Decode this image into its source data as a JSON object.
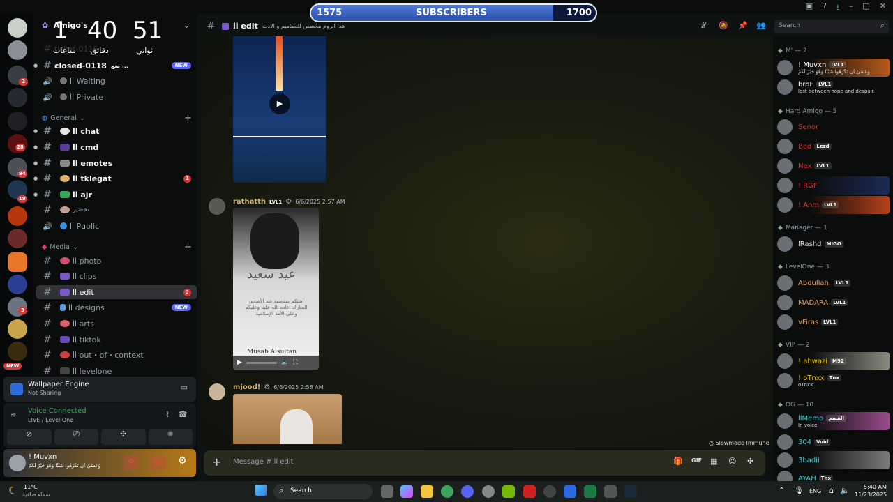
{
  "subscriber_bar": {
    "start": "1575",
    "label": "SUBSCRIBERS",
    "end": "1700",
    "progress_percent": 85
  },
  "timer": {
    "hours": "1",
    "minutes": "40",
    "seconds": "51",
    "hours_label": "ساعات",
    "minutes_label": "دقائق",
    "seconds_label": "ثواني"
  },
  "server": {
    "name": "Amigo's"
  },
  "channels_top": [
    {
      "name": "ticket-0116",
      "type": "text"
    },
    {
      "name": "closed-0118",
      "type": "text",
      "suffix": "ضع ...",
      "badge": "NEW"
    },
    {
      "name": "اا Waiting",
      "type": "voice"
    },
    {
      "name": "اا Private",
      "type": "voice"
    }
  ],
  "cat_general": "General",
  "general_channels": [
    {
      "name": "اا chat",
      "bold": true
    },
    {
      "name": "اا cmd",
      "bold": true
    },
    {
      "name": "اا emotes",
      "bold": true
    },
    {
      "name": "اا tklegat",
      "bold": true,
      "unread": "1"
    },
    {
      "name": "اا ajr",
      "bold": true
    },
    {
      "name": "تحضير",
      "bold": false
    },
    {
      "name": "اا Public",
      "bold": false,
      "voice": true
    }
  ],
  "cat_media": "Media",
  "media_channels": [
    {
      "name": "اا photo"
    },
    {
      "name": "اا clips"
    },
    {
      "name": "اا edit",
      "selected": true,
      "unread": "2"
    },
    {
      "name": "اا designs",
      "badge": "NEW"
    },
    {
      "name": "اا arts"
    },
    {
      "name": "اا tiktok"
    },
    {
      "name": "اا out・of・context"
    },
    {
      "name": "اا levelone"
    }
  ],
  "rail_badges": [
    "2",
    "28",
    "94",
    "19",
    "1",
    "3"
  ],
  "rail_new": "NEW",
  "wallpaper": {
    "title": "Wallpaper Engine",
    "subtitle": "Not Sharing"
  },
  "voice": {
    "status": "Voice Connected",
    "live": "LIVE",
    "level": "/ Level One"
  },
  "user": {
    "name": "! Muvxn",
    "status": "وَعَسَىٰ أَن تَكْرَهُوا شَيْئًا وَهُوَ خَيْرٌ لَّكُمْ"
  },
  "header": {
    "channel": "اا edit",
    "topic": "هذا الروم مخصص للتصاميم و الادت"
  },
  "search_placeholder": "Search",
  "messages": [
    {
      "author": "rathatth",
      "tag": "LVL1",
      "time": "6/6/2025 2:57 AM"
    },
    {
      "author": "mjood!",
      "time": "6/6/2025 2:58 AM"
    }
  ],
  "card": {
    "title": "عيد سعيد",
    "body": "أهنئكم بمناسبة عيد الأضحى المبارك أعاده الله علينا وعليكم وعلى الأمة الإسلامية",
    "sign": "Musab Alsultan"
  },
  "slowmode": "Slowmode Immune",
  "input_placeholder": "Message # اا edit",
  "member_groups": [
    {
      "title": "M' — 2",
      "members": [
        {
          "name": "! Muvxn",
          "tag": "LVL1",
          "sub": "وَعَسَىٰ أَن تَكْرَهُوا شَيْئًا وَهُوَ خَيْرٌ لَّكُمْ",
          "color": "#ffffff",
          "banner": "#b85a1c"
        },
        {
          "name": "broF",
          "tag": "LVL1",
          "sub": "lost between hope and despair.",
          "color": "#ffffff",
          "banner": ""
        }
      ]
    },
    {
      "title": "Hard Amigo — 5",
      "members": [
        {
          "name": "Senor",
          "color": "#c0392b",
          "banner": ""
        },
        {
          "name": "Bed",
          "tag": "Lezd",
          "color": "#e03030",
          "banner": ""
        },
        {
          "name": "Nex",
          "tag": "LVL1",
          "color": "#d93a3a",
          "banner": ""
        },
        {
          "name": "! RGF",
          "color": "#e03030",
          "banner": "#1c2a55"
        },
        {
          "name": "! Ahm",
          "tag": "LVL1",
          "color": "#e04040",
          "banner": "#b5401a"
        }
      ]
    },
    {
      "title": "Manager — 1",
      "members": [
        {
          "name": "lRashd",
          "tag": "MIGO",
          "color": "#dbdee1",
          "banner": ""
        }
      ]
    },
    {
      "title": "LevelOne — 3",
      "members": [
        {
          "name": "Abdullah.",
          "tag": "LVL1",
          "color": "#e0a36b",
          "banner": ""
        },
        {
          "name": "MADARA",
          "tag": "LVL1",
          "color": "#e0a36b",
          "banner": ""
        },
        {
          "name": "vFiras",
          "tag": "LVL1",
          "color": "#e0a36b",
          "banner": ""
        }
      ]
    },
    {
      "title": "VIP — 2",
      "members": [
        {
          "name": "! ahwazi",
          "tag": "M92",
          "color": "#f1c40f",
          "banner": "#8a8a80"
        },
        {
          "name": "! oTnxx",
          "tag": "Tnx",
          "sub": "oTnxx",
          "color": "#f1c40f",
          "banner": ""
        }
      ]
    },
    {
      "title": "OG — 10",
      "members": [
        {
          "name": "llMemo",
          "tag": "القسم",
          "sub": "In voice",
          "color": "#3ecfd6",
          "banner": "#9a4c8c"
        },
        {
          "name": "304",
          "tag": "Void",
          "color": "#3ecfd6",
          "banner": ""
        },
        {
          "name": "3badii",
          "sub": "",
          "color": "#3ecfd6",
          "banner": "#7a7a7a"
        },
        {
          "name": "AYAH",
          "tag": "Tnx",
          "color": "#3ecfd6",
          "banner": ""
        }
      ]
    }
  ],
  "taskbar": {
    "weather_temp": "11°C",
    "weather_text": "سماء صافية",
    "search": "Search",
    "lang": "ENG",
    "time": "5:40 AM",
    "date": "11/23/2025"
  }
}
